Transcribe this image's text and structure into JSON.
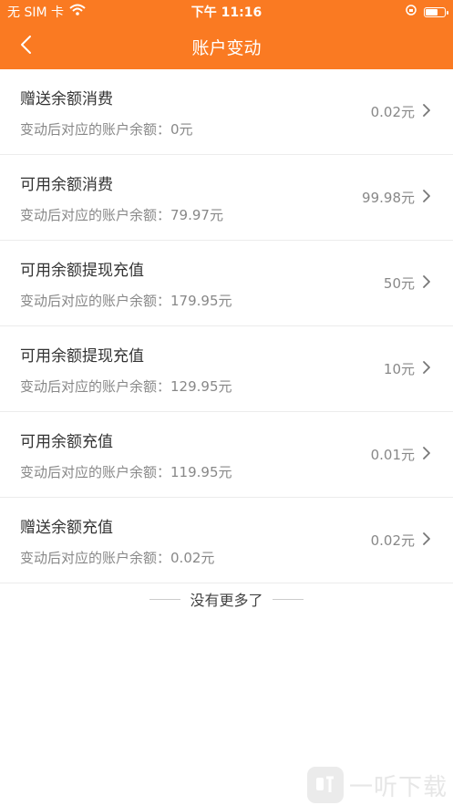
{
  "status_bar": {
    "carrier": "无 SIM 卡",
    "time": "下午 11:16"
  },
  "header": {
    "title": "账户变动"
  },
  "items": [
    {
      "title": "赠送余额消费",
      "subtitle": "变动后对应的账户余额：0元",
      "amount": "0.02元"
    },
    {
      "title": "可用余额消费",
      "subtitle": "变动后对应的账户余额：79.97元",
      "amount": "99.98元"
    },
    {
      "title": "可用余额提现充值",
      "subtitle": "变动后对应的账户余额：179.95元",
      "amount": "50元"
    },
    {
      "title": "可用余额提现充值",
      "subtitle": "变动后对应的账户余额：129.95元",
      "amount": "10元"
    },
    {
      "title": "可用余额充值",
      "subtitle": "变动后对应的账户余额：119.95元",
      "amount": "0.01元"
    },
    {
      "title": "赠送余额充值",
      "subtitle": "变动后对应的账户余额：0.02元",
      "amount": "0.02元"
    }
  ],
  "footer": {
    "no_more": "没有更多了"
  },
  "watermark": {
    "text": "一听下载"
  },
  "colors": {
    "accent": "#fa7a22"
  }
}
